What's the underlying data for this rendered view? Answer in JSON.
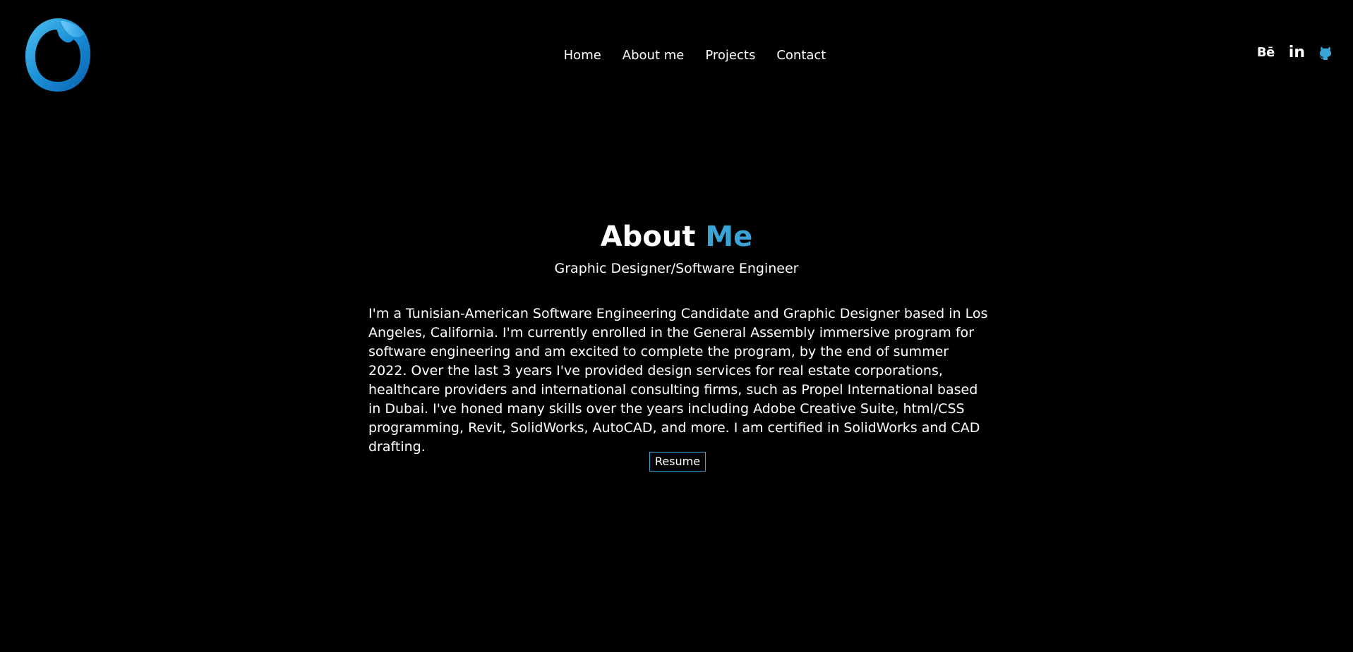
{
  "header": {
    "logo_icon": "circle-o-logo-icon",
    "nav": [
      {
        "label": "Home"
      },
      {
        "label": "About me"
      },
      {
        "label": "Projects"
      },
      {
        "label": "Contact"
      }
    ],
    "social": [
      {
        "icon": "behance-icon",
        "glyph": "Bē"
      },
      {
        "icon": "linkedin-icon",
        "glyph": "in"
      },
      {
        "icon": "github-icon"
      }
    ]
  },
  "about": {
    "title_main": "About",
    "title_accent": "Me",
    "subtitle": "Graphic Designer/Software Engineer",
    "bio": "I'm a Tunisian-American Software Engineering Candidate and Graphic Designer based in Los Angeles, California. I'm currently enrolled in the General Assembly immersive program for software engineering and am excited to complete the program, by the end of summer 2022. Over the last 3 years I've provided design services for real estate corporations, healthcare providers and international consulting firms, such as Propel International based in Dubai. I've honed many skills over the years including Adobe Creative Suite, html/CSS programming, Revit, SolidWorks, AutoCAD, and more. I am certified in SolidWorks and CAD drafting.",
    "resume_label": "Resume"
  },
  "colors": {
    "background": "#000000",
    "text": "#ffffff",
    "accent": "#3aa3d8"
  }
}
